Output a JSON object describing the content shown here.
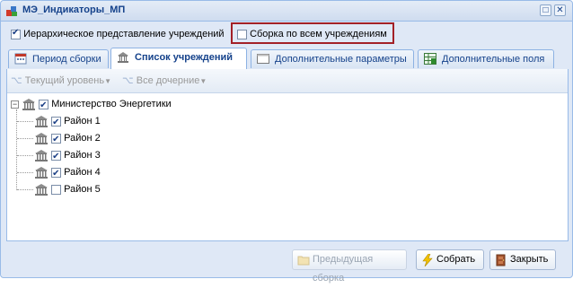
{
  "window": {
    "title": "МЭ_Индикаторы_МП"
  },
  "options": {
    "hierarchical_label": "Иерархическое представление учреждений",
    "hierarchical_checked": true,
    "collect_all_label": "Сборка по всем учреждениям",
    "collect_all_checked": false
  },
  "tabs": [
    {
      "label": "Период сборки",
      "icon": "calendar-icon",
      "active": false
    },
    {
      "label": "Список учреждений",
      "icon": "building-icon",
      "active": true
    },
    {
      "label": "Дополнительные параметры",
      "icon": "form-icon",
      "active": false
    },
    {
      "label": "Дополнительные поля",
      "icon": "table-icon",
      "active": false
    }
  ],
  "toolbar": {
    "current_level": "Текущий уровень",
    "all_children": "Все дочерние"
  },
  "tree": {
    "root": {
      "label": "Министерство Энергетики",
      "checked": true,
      "expanded": true
    },
    "children": [
      {
        "label": "Район 1",
        "checked": true
      },
      {
        "label": "Район 2",
        "checked": true
      },
      {
        "label": "Район 3",
        "checked": true
      },
      {
        "label": "Район 4",
        "checked": true
      },
      {
        "label": "Район 5",
        "checked": false
      }
    ]
  },
  "buttons": {
    "previous": "Предыдущая сборка",
    "collect": "Собрать",
    "close": "Закрыть"
  },
  "colors": {
    "highlight_border": "#a32027",
    "title_text": "#15428b"
  }
}
